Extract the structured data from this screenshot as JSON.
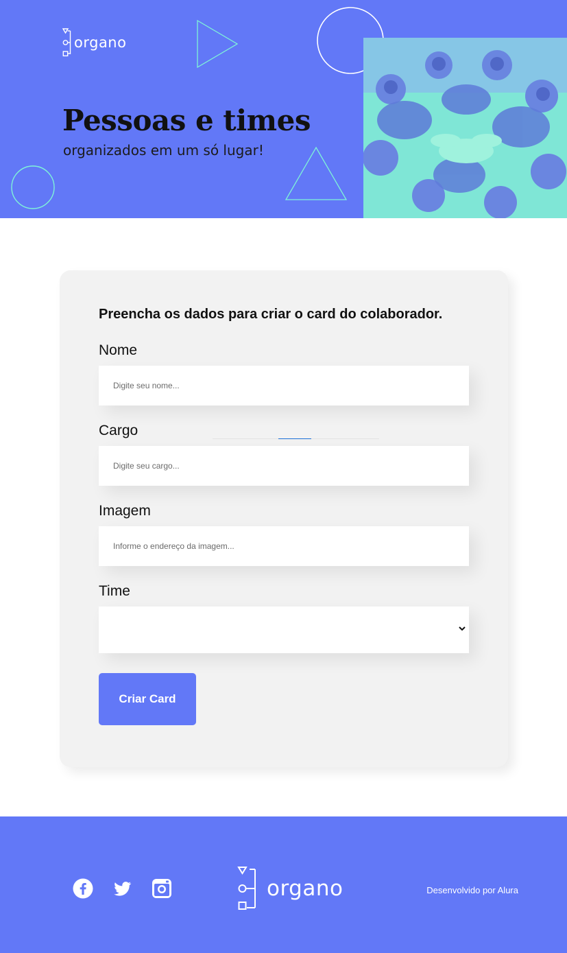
{
  "brand": {
    "name": "organo"
  },
  "banner": {
    "title": "Pessoas e times",
    "subtitle": "organizados em um só lugar!",
    "photo_icon": "team-hands-together-photo"
  },
  "form": {
    "title": "Preencha os dados para criar o card do colaborador.",
    "fields": [
      {
        "label": "Nome",
        "placeholder": "Digite seu nome...",
        "value": ""
      },
      {
        "label": "Cargo",
        "placeholder": "Digite seu cargo...",
        "value": ""
      },
      {
        "label": "Imagem",
        "placeholder": "Informe o endereço da imagem...",
        "value": ""
      }
    ],
    "select": {
      "label": "Time",
      "selected": ""
    },
    "submit_label": "Criar Card"
  },
  "footer": {
    "social": [
      {
        "icon": "facebook-icon"
      },
      {
        "icon": "twitter-icon"
      },
      {
        "icon": "instagram-icon"
      }
    ],
    "credit": "Desenvolvido por Alura"
  },
  "colors": {
    "brand_blue": "#6278F7",
    "accent_teal": "#7FF4D8",
    "card_bg": "#F2F2F2",
    "page_bg": "#FFFFFF"
  }
}
